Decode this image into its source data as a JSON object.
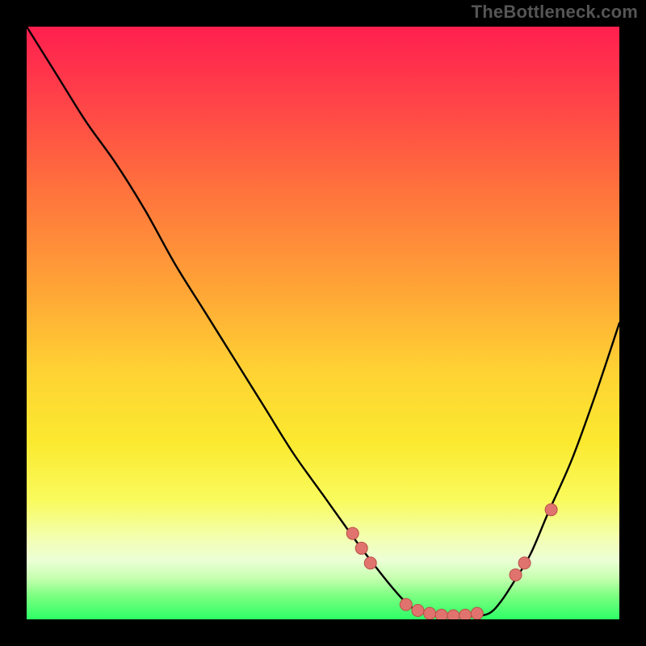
{
  "attribution": "TheBottleneck.com",
  "colors": {
    "frame": "#000000",
    "curve_stroke": "#000000",
    "marker_fill": "#e0736e",
    "marker_stroke": "#b94f48",
    "gradient_top": "#ff1f4e",
    "gradient_bottom": "#2dff66"
  },
  "chart_data": {
    "type": "line",
    "title": "",
    "xlabel": "",
    "ylabel": "",
    "xlim": [
      0,
      100
    ],
    "ylim": [
      0,
      100
    ],
    "series": [
      {
        "name": "bottleneck-curve",
        "x": [
          0,
          5,
          10,
          15,
          20,
          25,
          30,
          35,
          40,
          45,
          50,
          55,
          58,
          62,
          65,
          68,
          72,
          75,
          78,
          80,
          82,
          85,
          88,
          92,
          96,
          100
        ],
        "values": [
          100,
          92,
          84,
          77,
          69,
          60,
          52,
          44,
          36,
          28,
          21,
          14,
          10,
          5,
          2,
          1,
          0.5,
          0.5,
          1,
          3,
          6,
          11,
          18,
          27,
          38,
          50
        ]
      }
    ],
    "markers": [
      {
        "x": 55.0,
        "y": 14.5
      },
      {
        "x": 56.5,
        "y": 12.0
      },
      {
        "x": 58.0,
        "y": 9.5
      },
      {
        "x": 64.0,
        "y": 2.5
      },
      {
        "x": 66.0,
        "y": 1.5
      },
      {
        "x": 68.0,
        "y": 1.0
      },
      {
        "x": 70.0,
        "y": 0.7
      },
      {
        "x": 72.0,
        "y": 0.6
      },
      {
        "x": 74.0,
        "y": 0.7
      },
      {
        "x": 76.0,
        "y": 1.0
      },
      {
        "x": 82.5,
        "y": 7.5
      },
      {
        "x": 84.0,
        "y": 9.5
      },
      {
        "x": 88.5,
        "y": 18.5
      }
    ]
  }
}
